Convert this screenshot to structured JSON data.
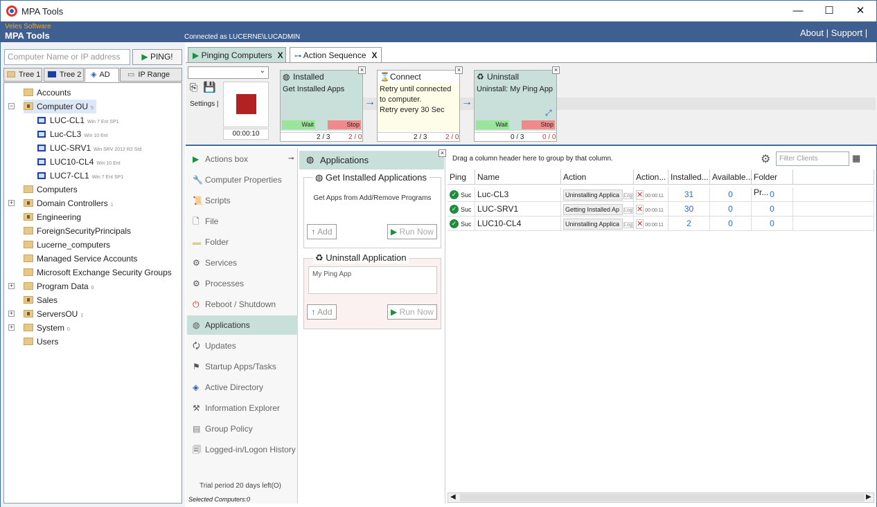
{
  "window": {
    "title": "MPA Tools",
    "minimize": "—",
    "maximize": "☐",
    "close": "✕"
  },
  "banner": {
    "company": "Veles Software",
    "app": "MPA Tools",
    "connected": "Connected as LUCERNE\\LUCADMIN",
    "links": "About | Support |"
  },
  "search": {
    "placeholder": "Computer Name or IP address",
    "ping": "PING!"
  },
  "left_tabs": [
    "Tree 1",
    "Tree 2",
    "AD",
    "IP Range"
  ],
  "tree": [
    {
      "label": "Accounts",
      "note": ""
    },
    {
      "label": "Computer OU",
      "note": "5"
    },
    {
      "label": "LUC-CL1",
      "note": "Win 7 Ent SP1"
    },
    {
      "label": "Luc-CL3",
      "note": "Win 10 Ent"
    },
    {
      "label": "LUC-SRV1",
      "note": "Win SRV 2012 R2 Std"
    },
    {
      "label": "LUC10-CL4",
      "note": "Win 10 Ent"
    },
    {
      "label": "LUC7-CL1",
      "note": "Win 7 Ent SP1"
    },
    {
      "label": "Computers",
      "note": ""
    },
    {
      "label": "Domain Controllers",
      "note": "1"
    },
    {
      "label": "Engineering",
      "note": ""
    },
    {
      "label": "ForeignSecurityPrincipals",
      "note": ""
    },
    {
      "label": "Lucerne_computers",
      "note": ""
    },
    {
      "label": "Managed Service Accounts",
      "note": ""
    },
    {
      "label": "Microsoft Exchange Security Groups",
      "note": ""
    },
    {
      "label": "Program Data",
      "note": "0"
    },
    {
      "label": "Sales",
      "note": ""
    },
    {
      "label": "ServersOU",
      "note": "1"
    },
    {
      "label": "System",
      "note": "0"
    },
    {
      "label": "Users",
      "note": ""
    }
  ],
  "doc_tabs": [
    {
      "label": "Pinging Computers",
      "close": "X"
    },
    {
      "label": "Action Sequence",
      "close": "X"
    }
  ],
  "seq_toolbar": {
    "settings": "Settings |",
    "timer": "00:00:10"
  },
  "seq_steps": [
    {
      "title": "Installed Applications",
      "body": "Get Installed Apps",
      "wait": "Wait",
      "stop": "Stop",
      "c1": "2 / 3",
      "c2": "2 / 0"
    },
    {
      "title": "Connect",
      "body": "Retry until connected to computer.\nRetry every 30 Sec",
      "wait": "",
      "stop": "",
      "c1": "2 / 3",
      "c2": "2 / 0"
    },
    {
      "title": "Uninstall Application",
      "body": "Uninstall: My Ping App",
      "wait": "Wait",
      "stop": "Stop",
      "c1": "0 / 3",
      "c2": "0 / 0"
    }
  ],
  "menu": [
    "Actions box",
    "Computer Properties",
    "Scripts",
    "File",
    "Folder",
    "Services",
    "Processes",
    "Reboot / Shutdown",
    "Applications",
    "Updates",
    "Startup Apps/Tasks",
    "Active Directory",
    "Information Explorer",
    "Group Policy",
    "Logged-in/Logon History"
  ],
  "trial": "Trial period 20 days left(O)",
  "selected": "Selected Computers:0",
  "apps_panel": {
    "title": "Applications",
    "box1": {
      "title": "Get Installed Applications",
      "desc": "Get Apps from Add/Remove Programs",
      "add": "Add",
      "run": "Run Now"
    },
    "box2": {
      "title": "Uninstall Application",
      "value": "My Ping App",
      "add": "Add",
      "run": "Run Now"
    }
  },
  "grid": {
    "hint": "Drag a column header here to group by that column.",
    "filter_placeholder": "Filter Clients",
    "headers": [
      "Ping",
      "Name",
      "Action",
      "Action...",
      "Installed...",
      "Available...",
      "Folder Pr..."
    ],
    "rows": [
      {
        "ping": "Suc",
        "name": "Luc-CL3",
        "action": "Uninstalling Applica",
        "log": "Log",
        "time": "00:00:11",
        "installed": "31",
        "available": "0",
        "folder": "0"
      },
      {
        "ping": "Suc",
        "name": "LUC-SRV1",
        "action": "Getting Installed Ap",
        "log": "Log",
        "time": "00:00:11",
        "installed": "30",
        "available": "0",
        "folder": "0"
      },
      {
        "ping": "Suc",
        "name": "LUC10-CL4",
        "action": "Uninstalling Applica",
        "log": "Log",
        "time": "00:00:11",
        "installed": "2",
        "available": "0",
        "folder": "0"
      }
    ]
  },
  "colors": {
    "banner": "#3f5f91",
    "accent": "#c8e0d9",
    "stop": "#b22222"
  }
}
